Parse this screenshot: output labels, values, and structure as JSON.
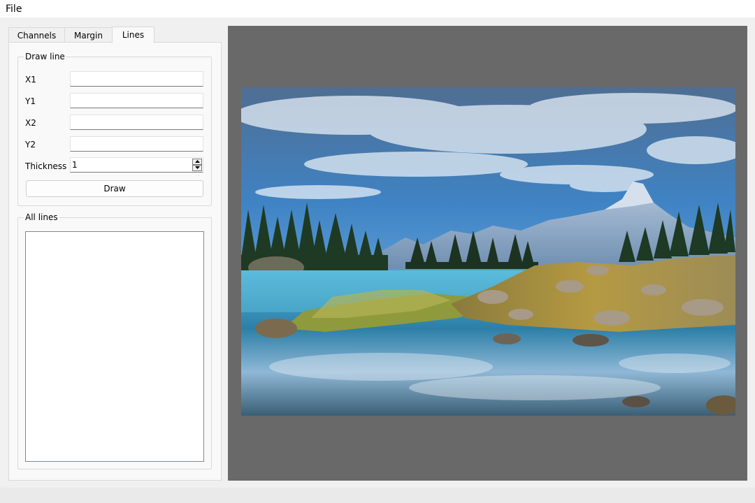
{
  "menu": {
    "file": "File"
  },
  "tabs": [
    {
      "label": "Channels"
    },
    {
      "label": "Margin"
    },
    {
      "label": "Lines"
    }
  ],
  "draw_line": {
    "title": "Draw line",
    "x1_label": "X1",
    "y1_label": "Y1",
    "x2_label": "X2",
    "y2_label": "Y2",
    "x1_value": "",
    "y1_value": "",
    "x2_value": "",
    "y2_value": "",
    "thickness_label": "Thickness",
    "thickness_value": "1",
    "draw_button": "Draw"
  },
  "all_lines": {
    "title": "All lines",
    "items": []
  },
  "icons": {
    "spin_up": "chevron-up-icon",
    "spin_down": "chevron-down-icon"
  },
  "colors": {
    "canvas_background": "#696969",
    "panel_background": "#f9f9f9"
  }
}
